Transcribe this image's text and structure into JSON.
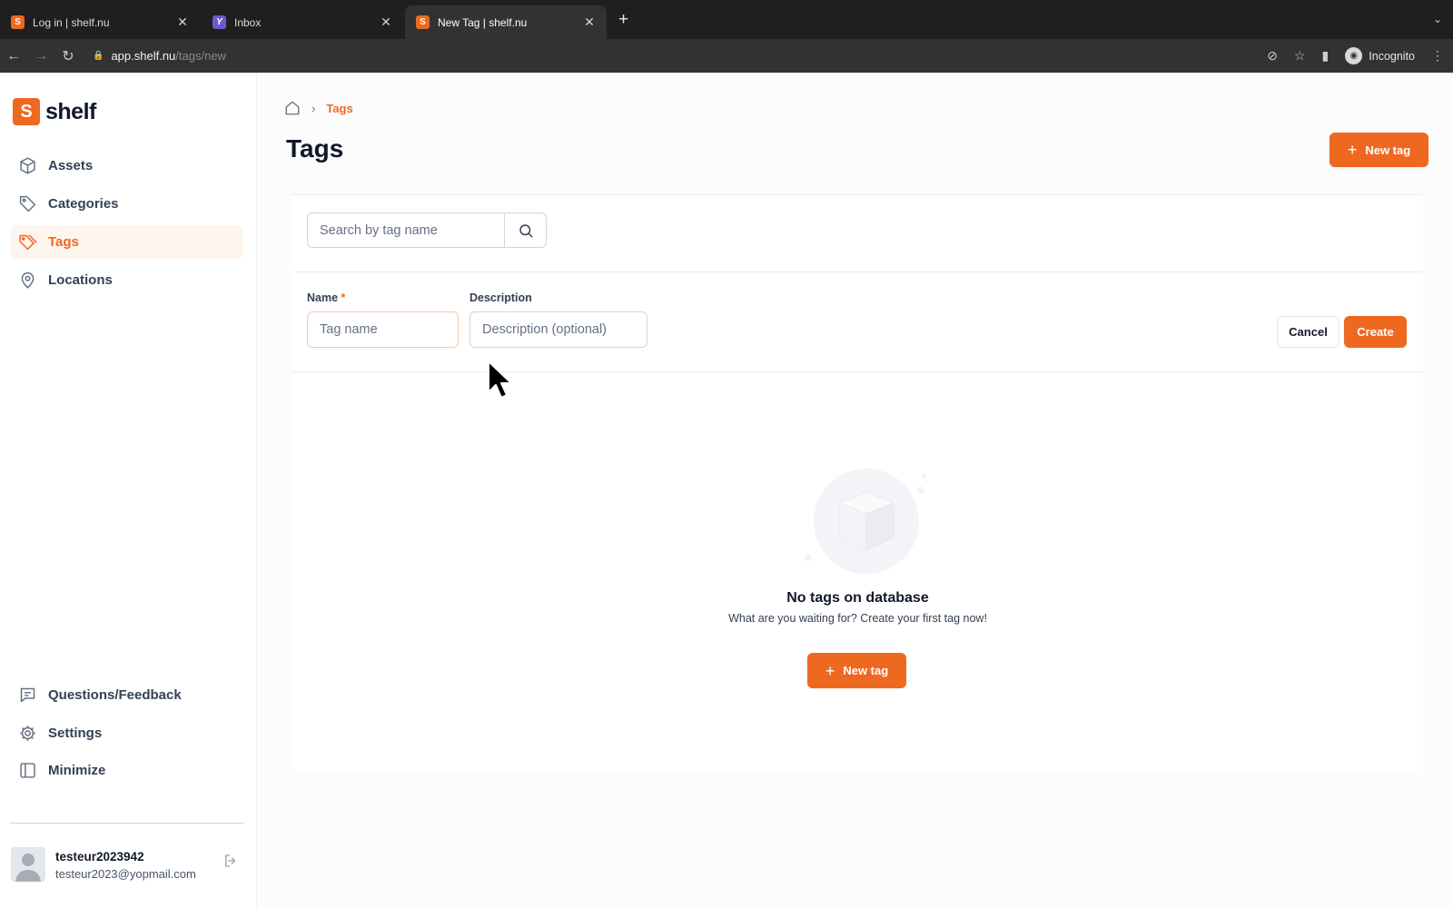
{
  "browser": {
    "tabs": [
      {
        "title": "Log in | shelf.nu",
        "favicon": "S"
      },
      {
        "title": "Inbox",
        "favicon": "Y"
      },
      {
        "title": "New Tag | shelf.nu",
        "favicon": "S"
      }
    ],
    "url_host": "app.shelf.nu",
    "url_path": "/tags/new",
    "profile": "Incognito"
  },
  "sidebar": {
    "logo_text": "shelf",
    "items": [
      {
        "label": "Assets",
        "icon": "cube-icon"
      },
      {
        "label": "Categories",
        "icon": "tag-icon"
      },
      {
        "label": "Tags",
        "icon": "tags-icon"
      },
      {
        "label": "Locations",
        "icon": "map-pin-icon"
      }
    ],
    "bottom_items": [
      {
        "label": "Questions/Feedback",
        "icon": "message-icon"
      },
      {
        "label": "Settings",
        "icon": "gear-icon"
      },
      {
        "label": "Minimize",
        "icon": "sidebar-icon"
      }
    ],
    "user": {
      "name": "testeur2023942",
      "email": "testeur2023@yopmail.com"
    }
  },
  "breadcrumb": {
    "current": "Tags"
  },
  "page": {
    "title": "Tags",
    "new_button": "New tag"
  },
  "search": {
    "placeholder": "Search by tag name"
  },
  "form": {
    "name_label": "Name",
    "required_mark": "*",
    "name_placeholder": "Tag name",
    "description_label": "Description",
    "description_placeholder": "Description (optional)",
    "cancel": "Cancel",
    "create": "Create"
  },
  "empty": {
    "title": "No tags on database",
    "subtitle": "What are you waiting for? Create your first tag now!",
    "button": "New tag"
  },
  "colors": {
    "accent": "#ef6820",
    "accent_light": "#fef6ee"
  }
}
